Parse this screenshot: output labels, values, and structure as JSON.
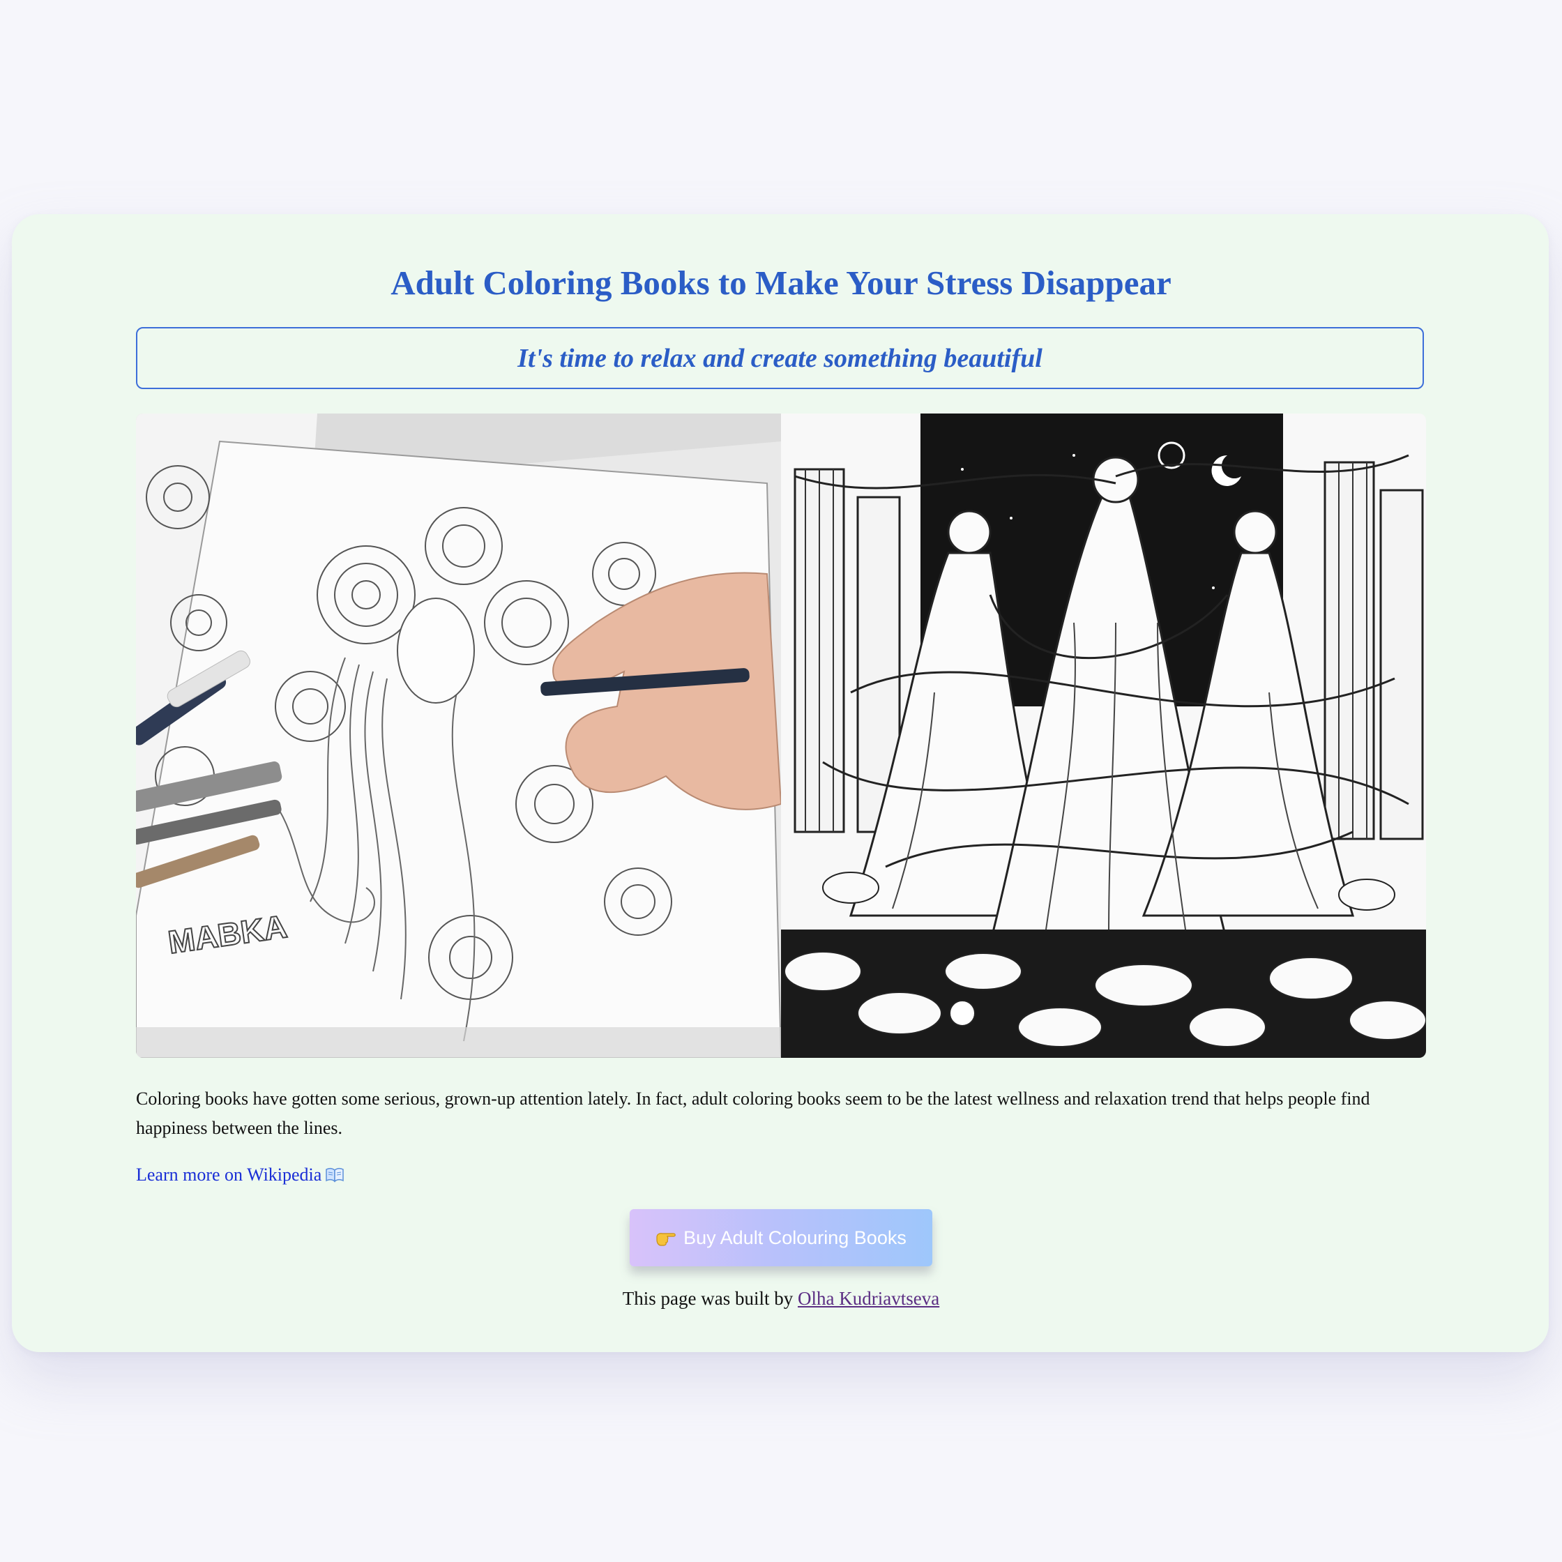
{
  "page": {
    "title": "Adult Coloring Books to Make Your Stress Disappear",
    "tagline": "It's time to relax and create something beautiful",
    "description": "Coloring books have gotten some serious, grown-up attention lately. In fact, adult coloring books seem to be the latest wellness and relaxation trend that helps people find happiness between the lines.",
    "wiki_link": "Learn more on Wikipedia",
    "wiki_icon": "open-book-icon",
    "buy_button": "Buy Adult Colouring Books",
    "buy_icon": "pointing-hand-icon",
    "footer_prefix": "This page was built by ",
    "footer_author": "Olha Kudriavtseva",
    "image_left_signature": "MABKA"
  },
  "colors": {
    "page_bg": "#f6f6fb",
    "card_bg": "#eef9ef",
    "heading": "#2b5dc6",
    "link": "#1a2fd6",
    "visited_link": "#5b2d83",
    "button_gradient_start": "#d8c2fa",
    "button_gradient_end": "#9ec7fb"
  }
}
